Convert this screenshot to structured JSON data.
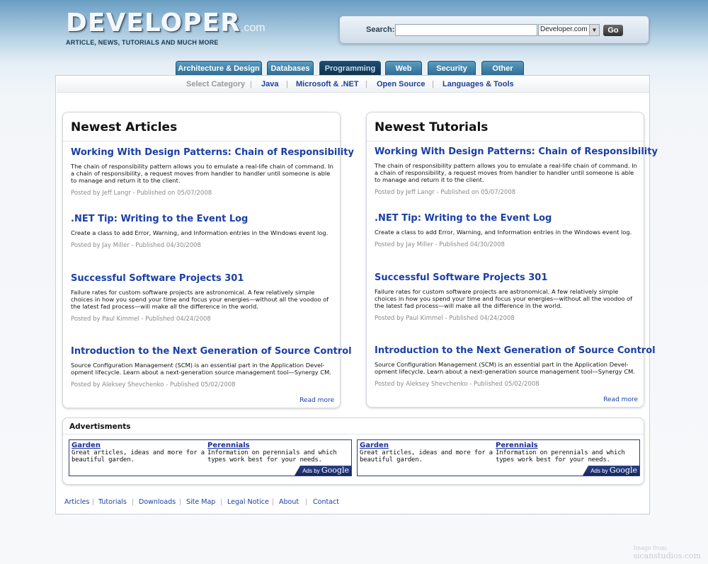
{
  "header": {
    "logo_main": "DEVELOPER",
    "logo_suffix": ".com",
    "tagline": "ARTICLE, NEWS, TUTORIALS AND MUCH MORE",
    "search_label": "Search:",
    "search_value": "",
    "search_scope": "Developer.com",
    "go_label": "Go"
  },
  "tabs": [
    {
      "label": "Architecture & Design"
    },
    {
      "label": "Databases"
    },
    {
      "label": "Programming"
    },
    {
      "label": "Web"
    },
    {
      "label": "Security"
    },
    {
      "label": "Other"
    }
  ],
  "active_tab": "Programming",
  "category_bar": {
    "prompt": "Select Category",
    "items": [
      "Java",
      "Microsoft & .NET",
      "Open Source",
      "Languages & Tools"
    ]
  },
  "articles": {
    "title": "Newest Articles",
    "read_more": "Read more",
    "items": [
      {
        "title": "Working With Design Patterns: Chain of Responsibility",
        "desc": "The chain of responsibility pattern allows you to emulate a real-life chain of command. In a chain of responsibility, a request moves from handler to handler until someone is able to manage and return it to the client.",
        "meta": "Posted by Jeff Langr - Published on 05/07/2008"
      },
      {
        "title": ".NET Tip: Writing to the Event Log",
        "desc": "Create a class to add Error, Warning, and Information entries in the Windows event log.",
        "meta": "Posted by Jay Miller - Published 04/30/2008"
      },
      {
        "title": "Successful Software Projects 301",
        "desc": "Failure rates for custom software projects are astronomical. A few relatively simple choices in how you spend your time and focus your energies—without all the voodoo of the latest fad process—will make all the difference in the world.",
        "meta": "Posted by Paul Kimmel - Published 04/24/2008"
      },
      {
        "title": "Introduction to the Next Generation of Source Control",
        "desc": "Source Configuration Management (SCM) is an essential part in the Application Devel-opment lifecycle. Learn about a next-generation source management tool—Synergy CM.",
        "meta": "Posted by Aleksey Shevchenko - Published 05/02/2008"
      }
    ]
  },
  "tutorials": {
    "title": "Newest Tutorials",
    "read_more": "Read more",
    "items": [
      {
        "title": "Working With Design Patterns: Chain of Responsibility",
        "desc": "The chain of responsibility pattern allows you to emulate a real-life chain of command. In a chain of responsibility, a request moves from handler to handler until someone is able to manage and return it to the client.",
        "meta": "Posted by Jeff Langr - Published on 05/07/2008"
      },
      {
        "title": ".NET Tip: Writing to the Event Log",
        "desc": "Create a class to add Error, Warning, and Information entries in the Windows event log.",
        "meta": "Posted by Jay Miller - Published 04/30/2008"
      },
      {
        "title": "Successful Software Projects 301",
        "desc": "Failure rates for custom software projects are astronomical. A few relatively simple choices in how you spend your time and focus your energies—without all the voodoo of the latest fad process—will make all the difference in the world.",
        "meta": "Posted by Paul Kimmel - Published 04/24/2008"
      },
      {
        "title": "Introduction to the Next Generation of Source Control",
        "desc": "Source Configuration Management (SCM) is an essential part in the Application Devel-opment lifecycle. Learn about a next-generation source management tool—Synergy CM.",
        "meta": "Posted by Aleksey Shevchenko - Published 05/02/2008"
      }
    ]
  },
  "ads": {
    "title": "Advertisments",
    "units": [
      {
        "items": [
          {
            "link": "Garden",
            "text": "Great articles, ideas and more for a beautiful garden."
          },
          {
            "link": "Perennials",
            "text": "Information on perennials and which types work best for your needs."
          }
        ],
        "ads_by": "Ads by",
        "brand": "Google"
      },
      {
        "items": [
          {
            "link": "Garden",
            "text": "Great articles, ideas and more for a beautiful garden."
          },
          {
            "link": "Perennials",
            "text": "Information on perennials and which types work best for your needs."
          }
        ],
        "ads_by": "Ads by",
        "brand": "Google"
      }
    ]
  },
  "footer": {
    "links": [
      "Articles",
      "Tutorials",
      "Downloads",
      "Site Map",
      "Legal Notice",
      "About",
      "Contact"
    ]
  },
  "credit": {
    "line1": "Image from",
    "line2": "sicanstudios.com"
  },
  "colors": {
    "link": "#1a3fa6",
    "tab": "#2f6d95",
    "tab_active": "#0e3450"
  }
}
